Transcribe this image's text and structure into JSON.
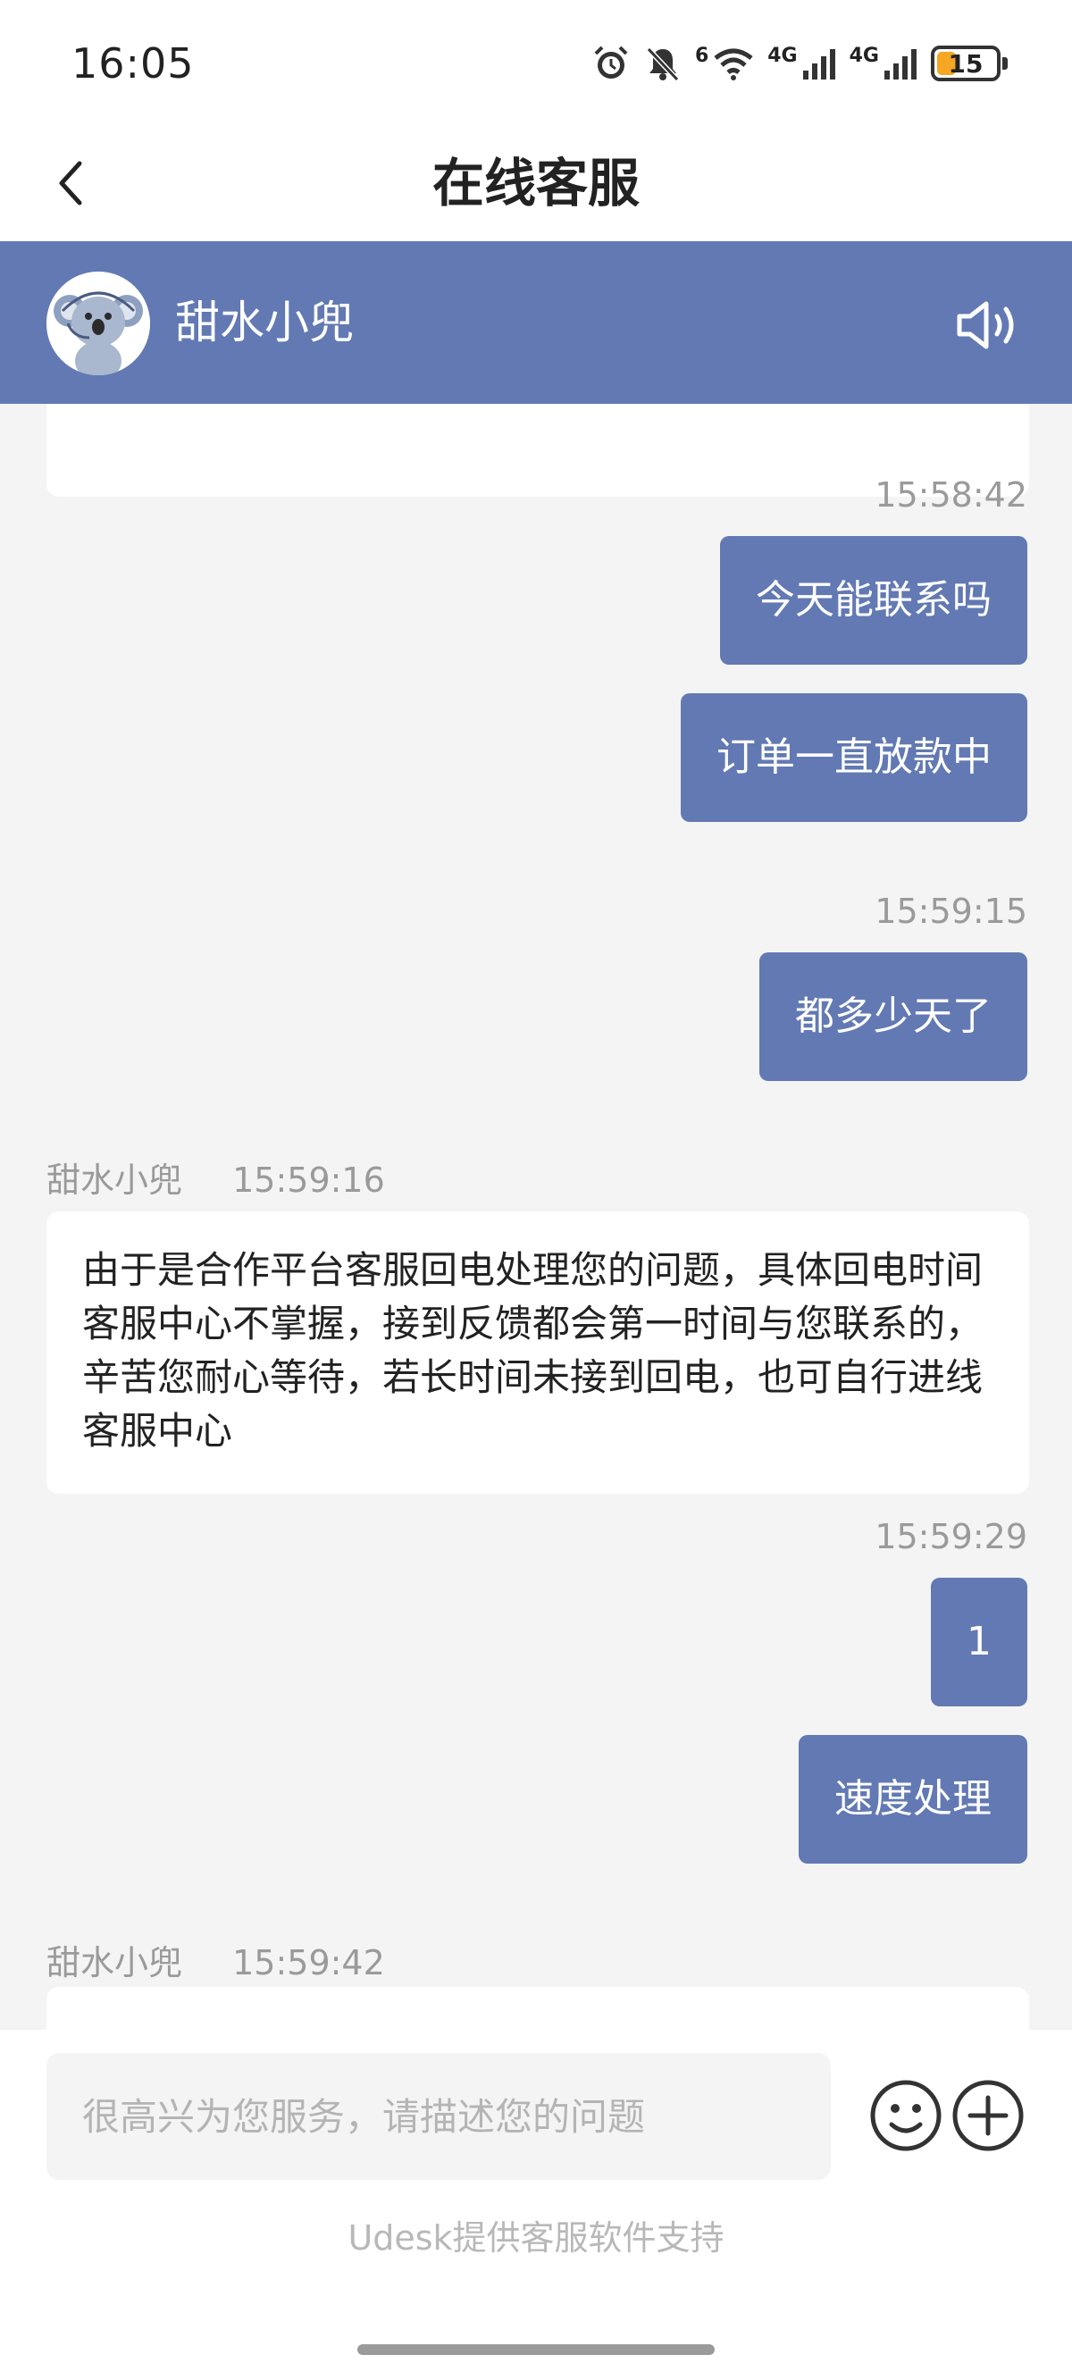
{
  "status_bar": {
    "time": "16:05",
    "battery_level": "15",
    "icons": [
      "alarm-icon",
      "mute-bell-icon",
      "wifi-icon",
      "signal-4g-icon",
      "signal-4g-icon",
      "battery-icon"
    ],
    "network_labels": [
      "4G",
      "4G"
    ],
    "wifi_label": "6"
  },
  "nav": {
    "title": "在线客服",
    "back_icon": "chevron-left-icon"
  },
  "agent": {
    "name": "甜水小兜",
    "avatar_icon": "koala-avatar-icon",
    "sound_icon": "speaker-icon"
  },
  "colors": {
    "accent": "#6279b3",
    "background": "#f4f4f4",
    "bubble_left": "#ffffff",
    "timestamp": "#9a9a9a",
    "battery": "#f5a623"
  },
  "messages": [
    {
      "side": "right",
      "time": "15:58:42",
      "text": "今天能联系吗"
    },
    {
      "side": "right",
      "time": "",
      "text": "订单一直放款中"
    },
    {
      "side": "right",
      "time": "15:59:15",
      "text": "都多少天了"
    },
    {
      "side": "left",
      "sender": "甜水小兜",
      "time": "15:59:16",
      "text": "由于是合作平台客服回电处理您的问题，具体回电时间客服中心不掌握，接到反馈都会第一时间与您联系的，辛苦您耐心等待，若长时间未接到回电，也可自行进线客服中心"
    },
    {
      "side": "right",
      "time": "15:59:29",
      "text": "1"
    },
    {
      "side": "right",
      "time": "",
      "text": "速度处理"
    },
    {
      "side": "left",
      "sender": "甜水小兜",
      "time": "15:59:42",
      "text": ""
    }
  ],
  "input": {
    "placeholder": "很高兴为您服务，请描述您的问题",
    "value": "",
    "emoji_icon": "smiley-icon",
    "plus_icon": "plus-circle-icon"
  },
  "footer": {
    "powered_by": "Udesk提供客服软件支持"
  }
}
